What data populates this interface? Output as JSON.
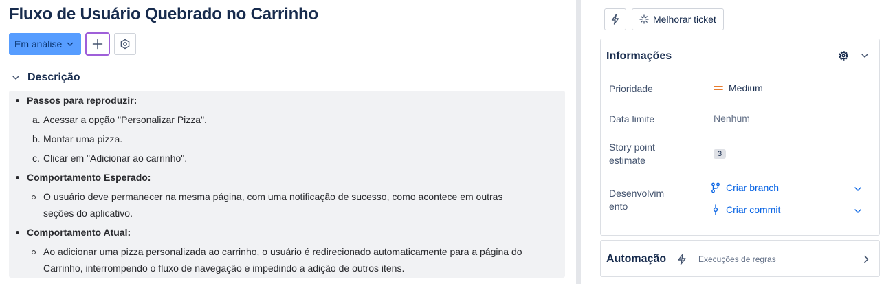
{
  "issue": {
    "title": "Fluxo de Usuário Quebrado no Carrinho",
    "status_label": "Em análise"
  },
  "description": {
    "header": "Descrição",
    "steps_heading": "Passos para reproduzir:",
    "steps": [
      {
        "marker": "a.",
        "text": "Acessar a opção \"Personalizar Pizza\"."
      },
      {
        "marker": "b.",
        "text": "Montar uma pizza."
      },
      {
        "marker": "c.",
        "text": "Clicar em \"Adicionar ao carrinho\"."
      }
    ],
    "expected_heading": "Comportamento Esperado:",
    "expected_lines": [
      "O usuário deve permanecer na mesma página, com uma notificação de sucesso, como acontece em outras",
      "seções do aplicativo."
    ],
    "actual_heading": "Comportamento Atual:",
    "actual_lines": [
      "Ao adicionar uma pizza personalizada ao carrinho, o usuário é redirecionado automaticamente para a página do",
      "Carrinho, interrompendo o fluxo de navegação e impedindo a adição de outros itens."
    ]
  },
  "sidebar": {
    "improve_label": "Melhorar ticket",
    "info": {
      "title": "Informações",
      "priority_label": "Prioridade",
      "priority_value": "Medium",
      "priority_color": "#e56910",
      "due_label": "Data limite",
      "due_value": "Nenhum",
      "story_label_1": "Story point",
      "story_label_2": "estimate",
      "story_value": "3",
      "dev_label_1": "Desenvolvim",
      "dev_label_2": "ento",
      "create_branch": "Criar branch",
      "create_commit": "Criar commit"
    },
    "automation": {
      "title": "Automação",
      "subtitle": "Execuções de regras"
    }
  },
  "colors": {
    "status_bg": "#579dff",
    "link": "#0c66e4",
    "focus_ring": "#9f5fd9"
  }
}
